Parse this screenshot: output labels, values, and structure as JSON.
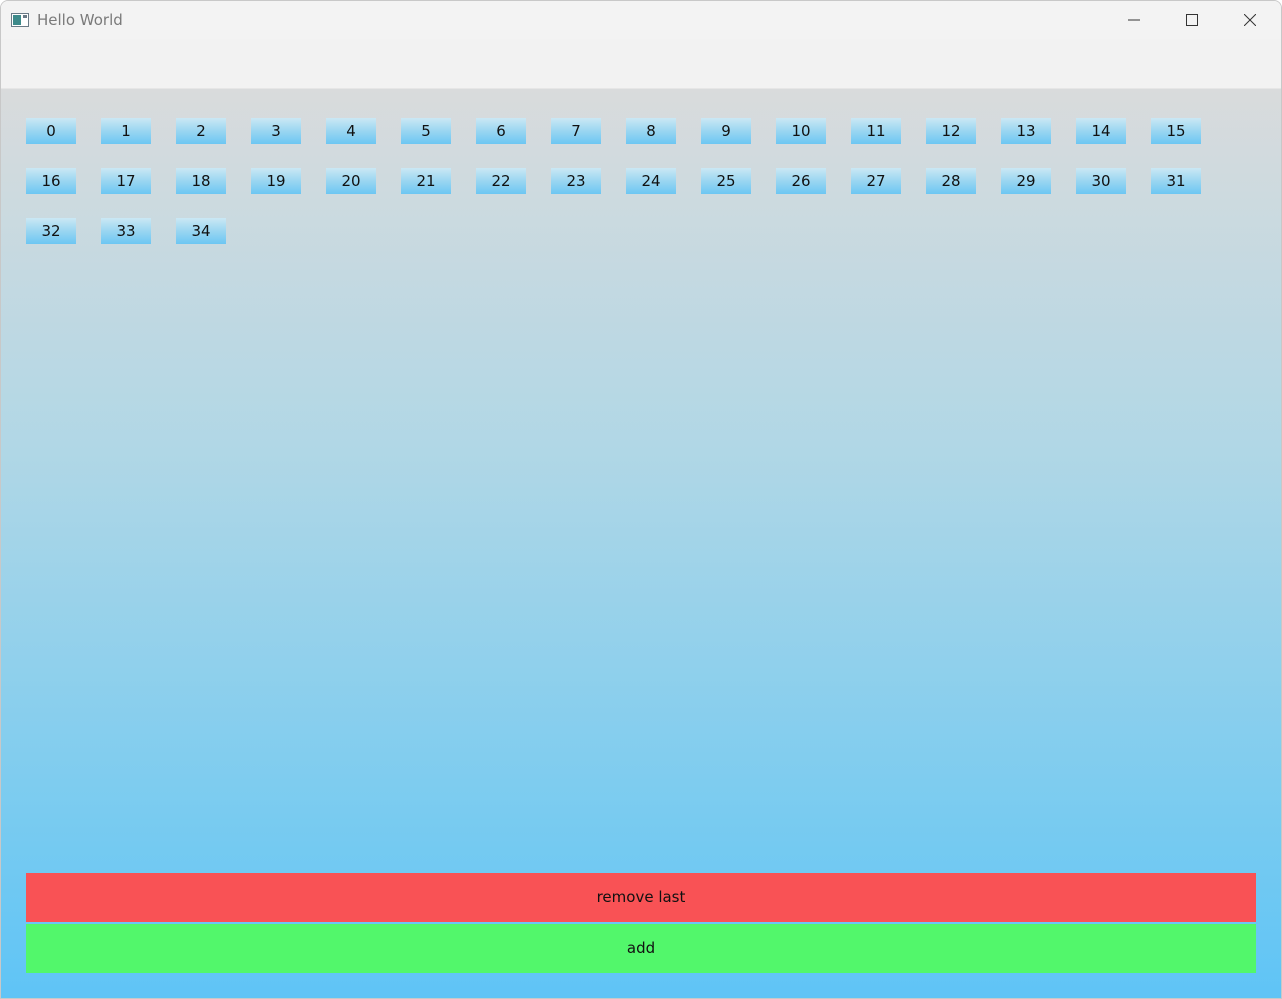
{
  "window": {
    "title": "Hello World"
  },
  "tiles": [
    "0",
    "1",
    "2",
    "3",
    "4",
    "5",
    "6",
    "7",
    "8",
    "9",
    "10",
    "11",
    "12",
    "13",
    "14",
    "15",
    "16",
    "17",
    "18",
    "19",
    "20",
    "21",
    "22",
    "23",
    "24",
    "25",
    "26",
    "27",
    "28",
    "29",
    "30",
    "31",
    "32",
    "33",
    "34"
  ],
  "buttons": {
    "remove_label": "remove last",
    "add_label": "add"
  },
  "colors": {
    "remove_button": "#f95255",
    "add_button": "#52f76b",
    "tile": "#9ad6f1",
    "background_top": "#d9dbdc",
    "background_bottom": "#5fc4f6"
  },
  "icons": {
    "app": "window-app-icon",
    "minimize": "minimize-icon",
    "maximize": "maximize-icon",
    "close": "close-icon"
  }
}
